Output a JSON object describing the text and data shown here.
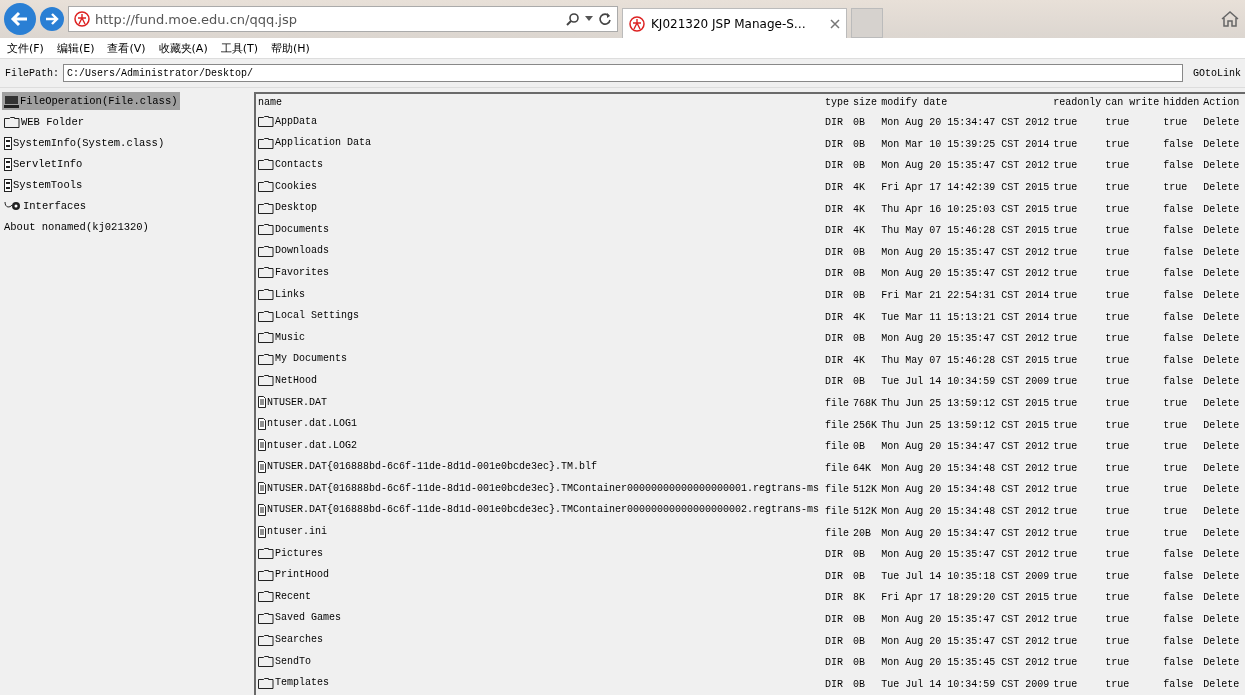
{
  "browser": {
    "url": "http://fund.moe.edu.cn/qqq.jsp",
    "tab": {
      "title": "KJ021320 JSP Manage-S…"
    }
  },
  "menu": [
    "文件(F)",
    "编辑(E)",
    "查看(V)",
    "收藏夹(A)",
    "工具(T)",
    "帮助(H)"
  ],
  "filepath": {
    "label": "FilePath:",
    "value": "C:/Users/Administrator/Desktop/",
    "button": "GOtoLink"
  },
  "sidebar": [
    {
      "label": "FileOperation(File.class)",
      "kind": "computer",
      "selected": true
    },
    {
      "label": "WEB Folder",
      "kind": "folder",
      "selected": false
    },
    {
      "label": "SystemInfo(System.class)",
      "kind": "applet",
      "selected": false
    },
    {
      "label": "ServletInfo",
      "kind": "applet",
      "selected": false
    },
    {
      "label": "SystemTools",
      "kind": "applet",
      "selected": false
    },
    {
      "label": "Interfaces",
      "kind": "plug",
      "selected": false
    },
    {
      "label": "About nonamed(kj021320)",
      "kind": "text",
      "selected": false
    }
  ],
  "table": {
    "columns": [
      "name",
      "type",
      "size",
      "modify date",
      "readonly",
      "can write",
      "hidden",
      "Action"
    ],
    "rows": [
      {
        "kind": "dir",
        "name": "AppData",
        "type": "DIR",
        "size": "0B",
        "date": "Mon Aug 20 15:34:47 CST 2012",
        "readonly": "true",
        "can_write": "true",
        "hidden": "true",
        "action": "Delete"
      },
      {
        "kind": "dir",
        "name": "Application Data",
        "type": "DIR",
        "size": "0B",
        "date": "Mon Mar 10 15:39:25 CST 2014",
        "readonly": "true",
        "can_write": "true",
        "hidden": "false",
        "action": "Delete"
      },
      {
        "kind": "dir",
        "name": "Contacts",
        "type": "DIR",
        "size": "0B",
        "date": "Mon Aug 20 15:35:47 CST 2012",
        "readonly": "true",
        "can_write": "true",
        "hidden": "false",
        "action": "Delete"
      },
      {
        "kind": "dir",
        "name": "Cookies",
        "type": "DIR",
        "size": "4K",
        "date": "Fri Apr 17 14:42:39 CST 2015",
        "readonly": "true",
        "can_write": "true",
        "hidden": "true",
        "action": "Delete"
      },
      {
        "kind": "dir",
        "name": "Desktop",
        "type": "DIR",
        "size": "4K",
        "date": "Thu Apr 16 10:25:03 CST 2015",
        "readonly": "true",
        "can_write": "true",
        "hidden": "false",
        "action": "Delete"
      },
      {
        "kind": "dir",
        "name": "Documents",
        "type": "DIR",
        "size": "4K",
        "date": "Thu May 07 15:46:28 CST 2015",
        "readonly": "true",
        "can_write": "true",
        "hidden": "false",
        "action": "Delete"
      },
      {
        "kind": "dir",
        "name": "Downloads",
        "type": "DIR",
        "size": "0B",
        "date": "Mon Aug 20 15:35:47 CST 2012",
        "readonly": "true",
        "can_write": "true",
        "hidden": "false",
        "action": "Delete"
      },
      {
        "kind": "dir",
        "name": "Favorites",
        "type": "DIR",
        "size": "0B",
        "date": "Mon Aug 20 15:35:47 CST 2012",
        "readonly": "true",
        "can_write": "true",
        "hidden": "false",
        "action": "Delete"
      },
      {
        "kind": "dir",
        "name": "Links",
        "type": "DIR",
        "size": "0B",
        "date": "Fri Mar 21 22:54:31 CST 2014",
        "readonly": "true",
        "can_write": "true",
        "hidden": "false",
        "action": "Delete"
      },
      {
        "kind": "dir",
        "name": "Local Settings",
        "type": "DIR",
        "size": "4K",
        "date": "Tue Mar 11 15:13:21 CST 2014",
        "readonly": "true",
        "can_write": "true",
        "hidden": "false",
        "action": "Delete"
      },
      {
        "kind": "dir",
        "name": "Music",
        "type": "DIR",
        "size": "0B",
        "date": "Mon Aug 20 15:35:47 CST 2012",
        "readonly": "true",
        "can_write": "true",
        "hidden": "false",
        "action": "Delete"
      },
      {
        "kind": "dir",
        "name": "My Documents",
        "type": "DIR",
        "size": "4K",
        "date": "Thu May 07 15:46:28 CST 2015",
        "readonly": "true",
        "can_write": "true",
        "hidden": "false",
        "action": "Delete"
      },
      {
        "kind": "dir",
        "name": "NetHood",
        "type": "DIR",
        "size": "0B",
        "date": "Tue Jul 14 10:34:59 CST 2009",
        "readonly": "true",
        "can_write": "true",
        "hidden": "false",
        "action": "Delete"
      },
      {
        "kind": "file",
        "name": "NTUSER.DAT",
        "type": "file",
        "size": "768K",
        "date": "Thu Jun 25 13:59:12 CST 2015",
        "readonly": "true",
        "can_write": "true",
        "hidden": "true",
        "action": "Delete"
      },
      {
        "kind": "file",
        "name": "ntuser.dat.LOG1",
        "type": "file",
        "size": "256K",
        "date": "Thu Jun 25 13:59:12 CST 2015",
        "readonly": "true",
        "can_write": "true",
        "hidden": "true",
        "action": "Delete"
      },
      {
        "kind": "file",
        "name": "ntuser.dat.LOG2",
        "type": "file",
        "size": "0B",
        "date": "Mon Aug 20 15:34:47 CST 2012",
        "readonly": "true",
        "can_write": "true",
        "hidden": "true",
        "action": "Delete"
      },
      {
        "kind": "file",
        "name": "NTUSER.DAT{016888bd-6c6f-11de-8d1d-001e0bcde3ec}.TM.blf",
        "type": "file",
        "size": "64K",
        "date": "Mon Aug 20 15:34:48 CST 2012",
        "readonly": "true",
        "can_write": "true",
        "hidden": "true",
        "action": "Delete"
      },
      {
        "kind": "file",
        "name": "NTUSER.DAT{016888bd-6c6f-11de-8d1d-001e0bcde3ec}.TMContainer00000000000000000001.regtrans-ms",
        "type": "file",
        "size": "512K",
        "date": "Mon Aug 20 15:34:48 CST 2012",
        "readonly": "true",
        "can_write": "true",
        "hidden": "true",
        "action": "Delete"
      },
      {
        "kind": "file",
        "name": "NTUSER.DAT{016888bd-6c6f-11de-8d1d-001e0bcde3ec}.TMContainer00000000000000000002.regtrans-ms",
        "type": "file",
        "size": "512K",
        "date": "Mon Aug 20 15:34:48 CST 2012",
        "readonly": "true",
        "can_write": "true",
        "hidden": "true",
        "action": "Delete"
      },
      {
        "kind": "file",
        "name": "ntuser.ini",
        "type": "file",
        "size": "20B",
        "date": "Mon Aug 20 15:34:47 CST 2012",
        "readonly": "true",
        "can_write": "true",
        "hidden": "true",
        "action": "Delete"
      },
      {
        "kind": "dir",
        "name": "Pictures",
        "type": "DIR",
        "size": "0B",
        "date": "Mon Aug 20 15:35:47 CST 2012",
        "readonly": "true",
        "can_write": "true",
        "hidden": "false",
        "action": "Delete"
      },
      {
        "kind": "dir",
        "name": "PrintHood",
        "type": "DIR",
        "size": "0B",
        "date": "Tue Jul 14 10:35:18 CST 2009",
        "readonly": "true",
        "can_write": "true",
        "hidden": "false",
        "action": "Delete"
      },
      {
        "kind": "dir",
        "name": "Recent",
        "type": "DIR",
        "size": "8K",
        "date": "Fri Apr 17 18:29:20 CST 2015",
        "readonly": "true",
        "can_write": "true",
        "hidden": "false",
        "action": "Delete"
      },
      {
        "kind": "dir",
        "name": "Saved Games",
        "type": "DIR",
        "size": "0B",
        "date": "Mon Aug 20 15:35:47 CST 2012",
        "readonly": "true",
        "can_write": "true",
        "hidden": "false",
        "action": "Delete"
      },
      {
        "kind": "dir",
        "name": "Searches",
        "type": "DIR",
        "size": "0B",
        "date": "Mon Aug 20 15:35:47 CST 2012",
        "readonly": "true",
        "can_write": "true",
        "hidden": "false",
        "action": "Delete"
      },
      {
        "kind": "dir",
        "name": "SendTo",
        "type": "DIR",
        "size": "0B",
        "date": "Mon Aug 20 15:35:45 CST 2012",
        "readonly": "true",
        "can_write": "true",
        "hidden": "false",
        "action": "Delete"
      },
      {
        "kind": "dir",
        "name": "Templates",
        "type": "DIR",
        "size": "0B",
        "date": "Tue Jul 14 10:34:59 CST 2009",
        "readonly": "true",
        "can_write": "true",
        "hidden": "false",
        "action": "Delete"
      }
    ]
  }
}
